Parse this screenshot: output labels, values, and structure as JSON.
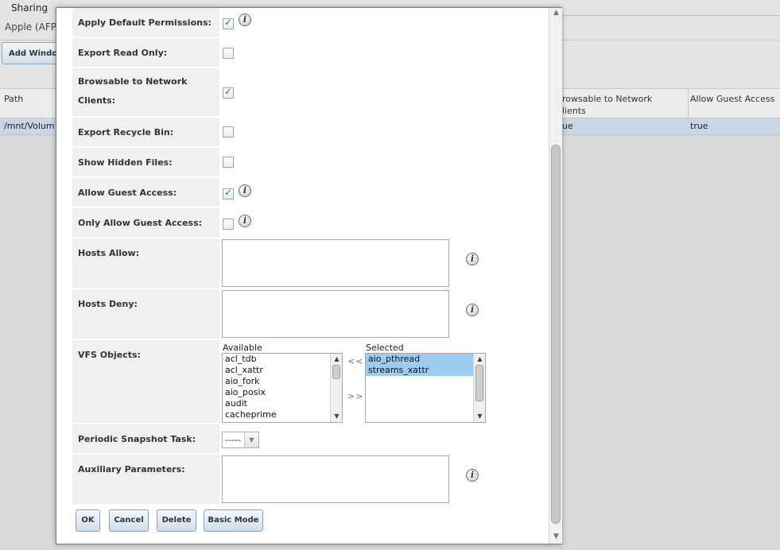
{
  "background": {
    "tab": "Sharing",
    "subtab": "Apple (AFP",
    "add_button": "Add Windo",
    "grid": {
      "headers": [
        "Path",
        "rowsable to Network\nlients",
        "Allow Guest Access"
      ],
      "row": [
        "/mnt/Volum",
        "ue",
        "true"
      ]
    }
  },
  "dialog": {
    "fields": {
      "apply_default_permissions": {
        "label": "Apply Default Permissions:",
        "checked": true
      },
      "export_read_only": {
        "label": "Export Read Only:",
        "checked": false
      },
      "browsable": {
        "label": "Browsable to Network Clients:",
        "checked": true
      },
      "export_recycle_bin": {
        "label": "Export Recycle Bin:",
        "checked": false
      },
      "show_hidden_files": {
        "label": "Show Hidden Files:",
        "checked": false
      },
      "allow_guest_access": {
        "label": "Allow Guest Access:",
        "checked": true
      },
      "only_allow_guest_access": {
        "label": "Only Allow Guest Access:",
        "checked": false
      },
      "hosts_allow": {
        "label": "Hosts Allow:",
        "value": ""
      },
      "hosts_deny": {
        "label": "Hosts Deny:",
        "value": ""
      },
      "vfs_objects": {
        "label": "VFS Objects:",
        "available_title": "Available",
        "selected_title": "Selected",
        "available": [
          "acl_tdb",
          "acl_xattr",
          "aio_fork",
          "aio_posix",
          "audit",
          "cacheprime"
        ],
        "selected": [
          "aio_pthread",
          "streams_xattr"
        ],
        "move_left": "<<",
        "move_right": ">>"
      },
      "periodic_snapshot_task": {
        "label": "Periodic Snapshot Task:",
        "value": "-----"
      },
      "auxiliary_parameters": {
        "label": "Auxiliary Parameters:",
        "value": ""
      }
    },
    "info_glyph": "i",
    "buttons": {
      "ok": "OK",
      "cancel": "Cancel",
      "delete": "Delete",
      "basic_mode": "Basic Mode"
    }
  }
}
